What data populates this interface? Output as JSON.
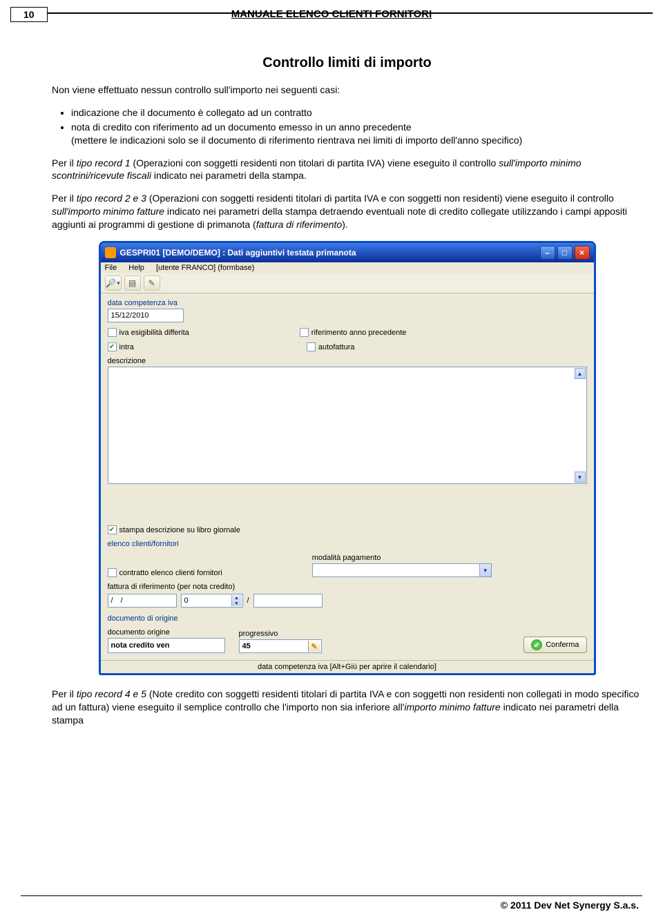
{
  "page_number": "10",
  "header_title": "MANUALE ELENCO CLIENTI FORNITORI",
  "h2": "Controllo limiti di importo",
  "intro": "Non viene effettuato nessun controllo sull'importo nei seguenti casi:",
  "bullets": {
    "b1": "indicazione che il documento è collegato ad un contratto",
    "b2a": "nota di credito con riferimento ad un documento emesso in un anno precedente",
    "b2b": "(mettere le indicazioni solo se il documento di riferimento rientrava nei limiti di importo dell'anno specifico)"
  },
  "p1": {
    "a": "Per il ",
    "b": "tipo record 1",
    "c": " (Operazioni con soggetti residenti non titolari di partita IVA) viene eseguito il controllo ",
    "d": "sull'importo minimo scontrini/ricevute fiscali",
    "e": " indicato nei parametri della stampa."
  },
  "p2": {
    "a": "Per il ",
    "b": "tipo record 2 e 3",
    "c": " (Operazioni con soggetti residenti titolari di partita IVA e con soggetti non residenti) viene eseguito il controllo ",
    "d": "sull'importo minimo fatture",
    "e": " indicato nei parametri della stampa detraendo eventuali note di credito collegate utilizzando i campi appositi aggiunti ai programmi di gestione di primanota (",
    "f": "fattura di riferimento",
    "g": ")."
  },
  "p3": {
    "a": "Per il ",
    "b": "tipo record 4 e 5",
    "c": " (Note credito con soggetti residenti titolari di partita IVA e con soggetti non residenti non collegati in modo specifico ad un fattura) viene eseguito il semplice controllo che l'importo non sia inferiore all'",
    "d": "importo minimo fatture",
    "e": "  indicato nei parametri della stampa"
  },
  "win": {
    "title": "GESPRI01 [DEMO/DEMO] : Dati aggiuntivi testata primanota",
    "menu_file": "File",
    "menu_help": "Help",
    "menu_user": "[utente FRANCO] (formbase)",
    "lbl_data_comp": "data competenza iva",
    "val_data_comp": "15/12/2010",
    "chk_iva": "iva esigibilità differita",
    "chk_rif_anno": "riferimento anno precedente",
    "chk_intra": "intra",
    "chk_autofattura": "autofattura",
    "lbl_descr": "descrizione",
    "chk_stampa": "stampa descrizione su libro giornale",
    "lbl_elenco": "elenco clienti/fornitori",
    "chk_contratto": "contratto elenco clienti fornitori",
    "lbl_modpag": "modalità pagamento",
    "lbl_fattura_rif": "fattura di riferimento (per nota credito)",
    "val_fat_date": "/  /",
    "val_fat_num": "0",
    "val_fat_sep": "/",
    "lbl_doc_origine_hdr": "documento di origine",
    "lbl_doc_origine": "documento origine",
    "val_doc_origine": "nota credito ven",
    "lbl_progressivo": "progressivo",
    "val_progressivo": "45",
    "btn_confirm": "Conferma",
    "status": "data competenza iva [Alt+Giù per aprire il calendario]"
  },
  "footer": "© 2011 Dev Net Synergy S.a.s."
}
